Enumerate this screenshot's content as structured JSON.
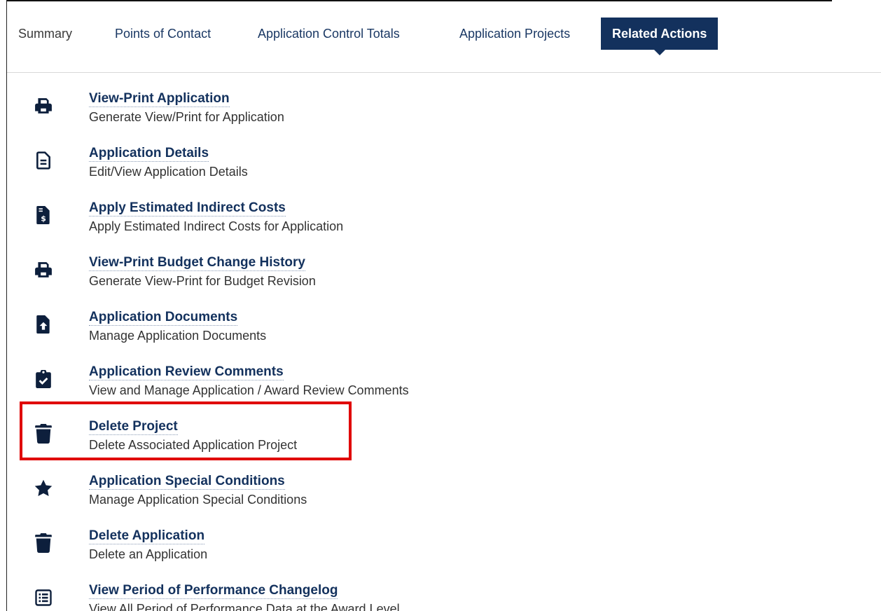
{
  "tabs": [
    {
      "label": "Summary"
    },
    {
      "label": "Points of Contact"
    },
    {
      "label": "Application Control Totals"
    },
    {
      "label": "Application Projects"
    },
    {
      "label": "Related Actions",
      "active": true
    }
  ],
  "actions": [
    {
      "icon": "printer-icon",
      "title": "View-Print Application",
      "desc": "Generate View/Print for Application"
    },
    {
      "icon": "document-icon",
      "title": "Application Details",
      "desc": "Edit/View Application Details"
    },
    {
      "icon": "invoice-dollar-icon",
      "title": "Apply Estimated Indirect Costs",
      "desc": "Apply Estimated Indirect Costs for Application"
    },
    {
      "icon": "printer-icon",
      "title": "View-Print Budget Change History",
      "desc": "Generate View-Print for Budget Revision"
    },
    {
      "icon": "file-upload-icon",
      "title": "Application Documents",
      "desc": "Manage Application Documents"
    },
    {
      "icon": "clipboard-check-icon",
      "title": "Application Review Comments",
      "desc": "View and Manage Application / Award Review Comments"
    },
    {
      "icon": "trash-icon",
      "title": "Delete Project",
      "desc": "Delete Associated Application Project"
    },
    {
      "icon": "star-icon",
      "title": "Application Special Conditions",
      "desc": "Manage Application Special Conditions"
    },
    {
      "icon": "trash-icon",
      "title": "Delete Application",
      "desc": "Delete an Application"
    },
    {
      "icon": "list-icon",
      "title": "View Period of Performance Changelog",
      "desc": "View All Period of Performance Data at the Award Level"
    }
  ],
  "colors": {
    "accent": "#13315d",
    "highlight": "#e00000",
    "icon": "#0d1f3c"
  }
}
